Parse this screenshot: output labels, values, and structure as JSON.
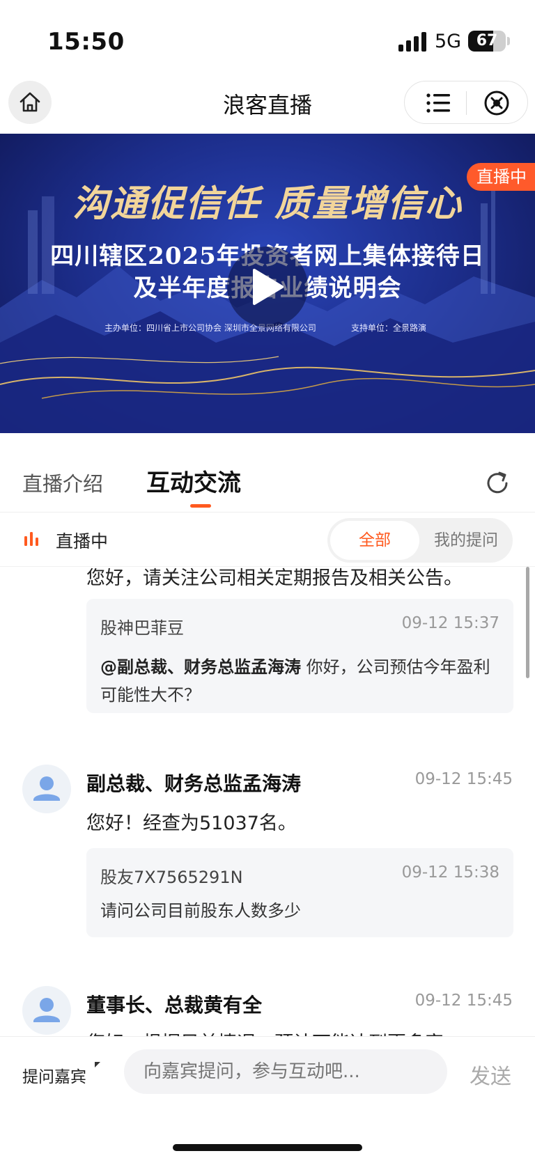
{
  "status_bar": {
    "time": "15:50",
    "network": "5G",
    "battery": "67",
    "battery_level": 0.67
  },
  "nav": {
    "title": "浪客直播"
  },
  "banner": {
    "live_badge": "直播中",
    "title": "沟通促信任 质量增信心",
    "subtitle_line1": "四川辖区2025年投资者网上集体接待日",
    "subtitle_line2": "及半年度报告业绩说明会",
    "host": "主办单位：四川省上市公司协会  深圳市全景网络有限公司",
    "support": "支持单位：全景路演"
  },
  "tabs": {
    "intro": "直播介绍",
    "chat": "互动交流"
  },
  "filter": {
    "live_label": "直播中",
    "all": "全部",
    "mine": "我的提问"
  },
  "feed": {
    "partial_answer": "您好，请关注公司相关定期报告及相关公告。",
    "q1": {
      "user": "股神巴菲豆",
      "time": "09-12 15:37",
      "mention": "@副总裁、财务总监孟海涛",
      "text": "  你好，公司预估今年盈利可能性大不？"
    },
    "a2": {
      "name": "副总裁、财务总监孟海涛",
      "time": "09-12 15:45",
      "text": "您好！经查为51037名。"
    },
    "q2": {
      "user": "股友7X7565291N",
      "time": "09-12 15:38",
      "text": "请问公司目前股东人数多少"
    },
    "a3": {
      "name": "董事长、总裁黄有全",
      "time": "09-12 15:45",
      "text": "您好，根据目前情况，预计可能达到更多家"
    }
  },
  "bottom": {
    "ask_guest": "提问嘉宾",
    "placeholder": "向嘉宾提问，参与互动吧...",
    "send": "发送"
  },
  "colors": {
    "accent": "#ff5a1f",
    "live_badge": "#ff5a2b"
  }
}
